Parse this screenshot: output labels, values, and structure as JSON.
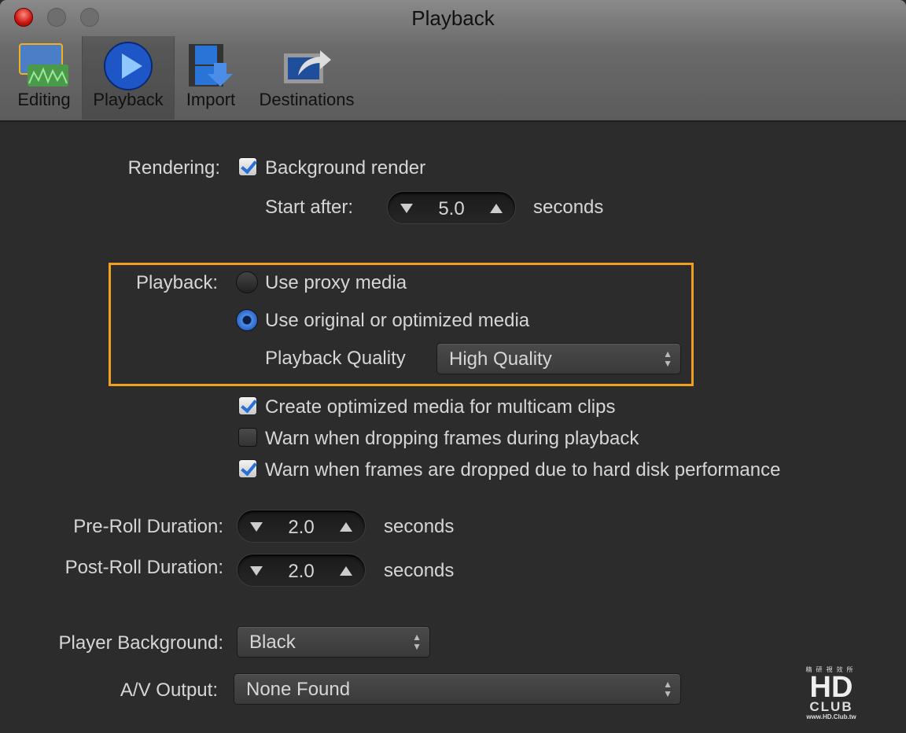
{
  "window": {
    "title": "Playback"
  },
  "toolbar": {
    "items": [
      {
        "label": "Editing",
        "icon": "editing-icon"
      },
      {
        "label": "Playback",
        "icon": "play-icon",
        "selected": true
      },
      {
        "label": "Import",
        "icon": "import-icon"
      },
      {
        "label": "Destinations",
        "icon": "share-icon"
      }
    ]
  },
  "rendering": {
    "label": "Rendering:",
    "background_render": {
      "label": "Background render",
      "checked": true
    },
    "start_after": {
      "label": "Start after:",
      "value": "5.0",
      "unit": "seconds"
    }
  },
  "playback": {
    "label": "Playback:",
    "proxy": {
      "label": "Use proxy media",
      "selected": false
    },
    "original": {
      "label": "Use original or optimized media",
      "selected": true
    },
    "quality": {
      "label": "Playback Quality",
      "value": "High Quality"
    }
  },
  "options": [
    {
      "label": "Create optimized media for multicam clips",
      "checked": true
    },
    {
      "label": "Warn when dropping frames during playback",
      "checked": false
    },
    {
      "label": "Warn when frames are dropped due to hard disk performance",
      "checked": true
    }
  ],
  "preroll": {
    "label": "Pre-Roll Duration:",
    "value": "2.0",
    "unit": "seconds"
  },
  "postroll": {
    "label": "Post-Roll Duration:",
    "value": "2.0",
    "unit": "seconds"
  },
  "player_background": {
    "label": "Player Background:",
    "value": "Black"
  },
  "av_output": {
    "label": "A/V Output:",
    "value": "None Found"
  },
  "watermark": {
    "top": "精研視效所",
    "main": "HD",
    "sub": "CLUB",
    "url": "www.HD.Club.tw"
  },
  "colors": {
    "highlight": "#f0a020",
    "accent": "#2a6fd6"
  }
}
